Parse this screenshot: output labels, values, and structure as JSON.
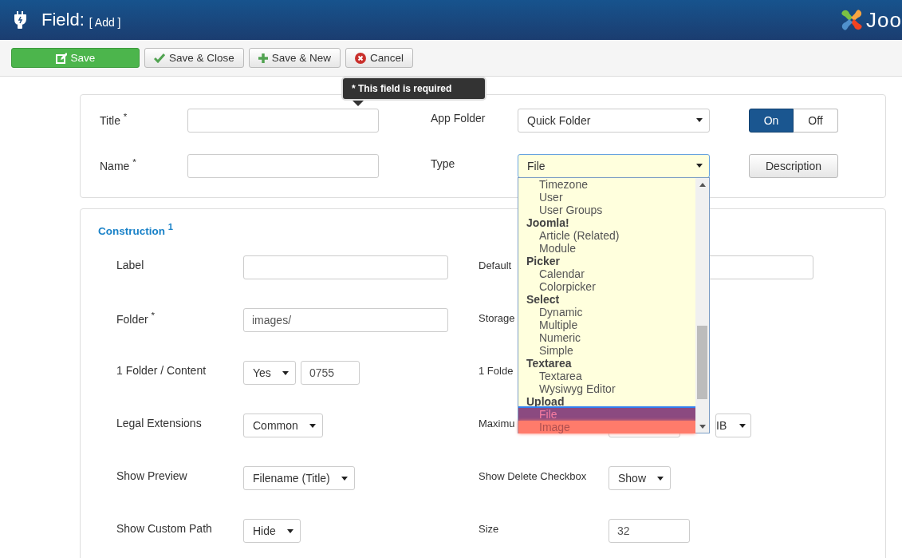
{
  "header": {
    "title": "Field:",
    "subtitle": "[ Add ]",
    "logo_text": "Joo"
  },
  "toolbar": [
    {
      "kind": "save",
      "label": "Save",
      "primary": true
    },
    {
      "kind": "check",
      "label": "Save & Close",
      "primary": false
    },
    {
      "kind": "plus",
      "label": "Save & New",
      "primary": false
    },
    {
      "kind": "cancel",
      "label": "Cancel",
      "primary": false
    }
  ],
  "tooltip": "* This field is required",
  "details": {
    "title_label": "Title $^{*}$",
    "name_label": "Name $^{*}$",
    "app_folder": {
      "label": "App Folder",
      "value": "Quick Folder"
    },
    "type": {
      "label": "Type",
      "value": "File",
      "expanded": true
    },
    "toggle": [
      {
        "label": "On",
        "selected": true
      },
      {
        "label": "Off",
        "selected": false
      }
    ],
    "description_button": "Description"
  },
  "type_options": [
    {
      "kind": "option",
      "label": "Timezone",
      "selected": false,
      "highlighted": false
    },
    {
      "kind": "option",
      "label": "User",
      "selected": false,
      "highlighted": false
    },
    {
      "kind": "option",
      "label": "User Groups",
      "selected": false,
      "highlighted": false
    },
    {
      "kind": "group",
      "label": "Joomla!"
    },
    {
      "kind": "option",
      "label": "Article (Related)",
      "selected": false,
      "highlighted": false
    },
    {
      "kind": "option",
      "label": "Module",
      "selected": false,
      "highlighted": false
    },
    {
      "kind": "group",
      "label": "Picker"
    },
    {
      "kind": "option",
      "label": "Calendar",
      "selected": false,
      "highlighted": false
    },
    {
      "kind": "option",
      "label": "Colorpicker",
      "selected": false,
      "highlighted": false
    },
    {
      "kind": "group",
      "label": "Select"
    },
    {
      "kind": "option",
      "label": "Dynamic",
      "selected": false,
      "highlighted": false
    },
    {
      "kind": "option",
      "label": "Multiple",
      "selected": false,
      "highlighted": false
    },
    {
      "kind": "option",
      "label": "Numeric",
      "selected": false,
      "highlighted": false
    },
    {
      "kind": "option",
      "label": "Simple",
      "selected": false,
      "highlighted": false
    },
    {
      "kind": "group",
      "label": "Textarea"
    },
    {
      "kind": "option",
      "label": "Textarea",
      "selected": false,
      "highlighted": false
    },
    {
      "kind": "option",
      "label": "Wysiwyg Editor",
      "selected": false,
      "highlighted": false
    },
    {
      "kind": "group",
      "label": "Upload"
    },
    {
      "kind": "option",
      "label": "File",
      "selected": true,
      "highlighted": false
    },
    {
      "kind": "option",
      "label": "Image",
      "selected": false,
      "highlighted": true
    }
  ],
  "construction": {
    "heading": "Construction $^{1}$",
    "left": [
      {
        "label": "Label",
        "kind": "text"
      },
      {
        "label": "Folder $^{*}$",
        "kind": "text",
        "value": "images/"
      },
      {
        "label": "1 Folder / Content",
        "kind": "select_text",
        "select": "Yes",
        "value": "0755"
      },
      {
        "label": "Legal Extensions",
        "kind": "select",
        "select": "Common"
      },
      {
        "label": "Show Preview",
        "kind": "select",
        "select": "Filename (Title)"
      },
      {
        "label": "Show Custom Path",
        "kind": "select",
        "select": "Hide"
      }
    ],
    "right": [
      {
        "label": "Default",
        "kind": "text"
      },
      {
        "label": "Storage",
        "kind": "none"
      },
      {
        "label": "1 Folde",
        "kind": "none"
      },
      {
        "label": "Maximu",
        "kind": "text_select",
        "select": "IB"
      },
      {
        "label": "Show Delete Checkbox",
        "kind": "select",
        "select": "Show"
      },
      {
        "label": "Size",
        "kind": "text",
        "value": "32"
      }
    ]
  }
}
